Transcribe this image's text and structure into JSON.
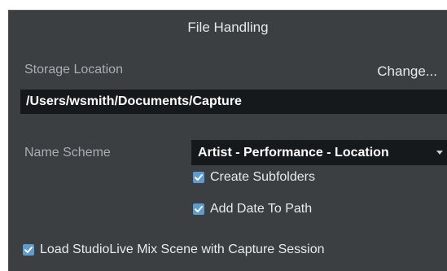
{
  "dialog": {
    "title": "File Handling"
  },
  "storage": {
    "label": "Storage Location",
    "change_label": "Change...",
    "path": "/Users/wsmith/Documents/Capture"
  },
  "name_scheme": {
    "label": "Name Scheme",
    "selected": "Artist - Performance - Location"
  },
  "options": {
    "create_subfolders": {
      "label": "Create Subfolders",
      "checked": true
    },
    "add_date_to_path": {
      "label": "Add Date To Path",
      "checked": true
    },
    "load_mix_scene": {
      "label": "Load StudioLive Mix Scene with Capture Session",
      "checked": true
    }
  },
  "colors": {
    "panel_bg": "#3b3f42",
    "field_bg": "#15191c",
    "checkbox_accent": "#5e9bcf",
    "muted_label": "#a9aeb2"
  }
}
